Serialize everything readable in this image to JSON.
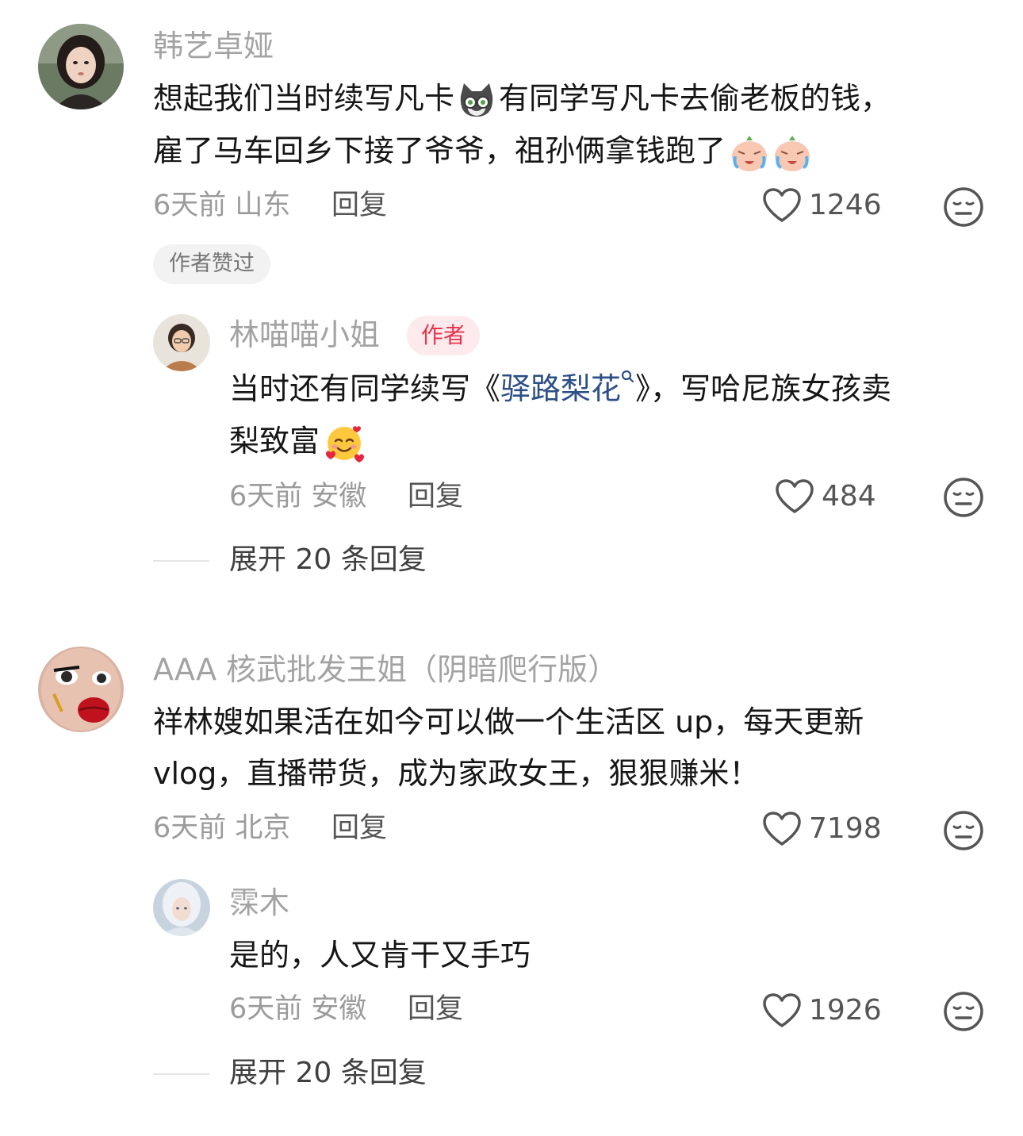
{
  "comments": [
    {
      "username": "韩艺卓娅",
      "text_line1_a": "想起我们当时续写凡卡",
      "text_line1_b": "有同学写凡卡去偷老板的钱，",
      "text_line2": "雇了马车回乡下接了爷爷，祖孙俩拿钱跑了",
      "time_location": "6天前 山东",
      "reply_label": "回复",
      "likes": "1246",
      "liked_badge": "作者赞过",
      "reply": {
        "username": "林喵喵小姐",
        "author_tag": "作者",
        "text_line1_a": "当时还有同学续写《",
        "text_line1_link": "驿路梨花",
        "text_line1_b": "》，写哈尼族女孩卖",
        "text_line2": "梨致富",
        "time_location": "6天前 安徽",
        "reply_label": "回复",
        "likes": "484"
      },
      "expand_label": "展开 20 条回复"
    },
    {
      "username": "AAA 核武批发王姐（阴暗爬行版）",
      "text_line1": "祥林嫂如果活在如今可以做一个生活区 up，每天更新",
      "text_line2": "vlog，直播带货，成为家政女王，狠狠赚米！",
      "time_location": "6天前 北京",
      "reply_label": "回复",
      "likes": "7198",
      "reply": {
        "username": "霂木",
        "text_line1": "是的，人又肯干又手巧",
        "time_location": "6天前 安徽",
        "reply_label": "回复",
        "likes": "1926"
      },
      "expand_label": "展开 20 条回复"
    }
  ],
  "icons": {
    "like": "heart-outline-icon",
    "dislike": "neutral-face-icon",
    "search": "search-icon"
  },
  "colors": {
    "link": "#2c4f86",
    "author_tag_bg": "#fdeaed",
    "author_tag_text": "#e8334d"
  }
}
